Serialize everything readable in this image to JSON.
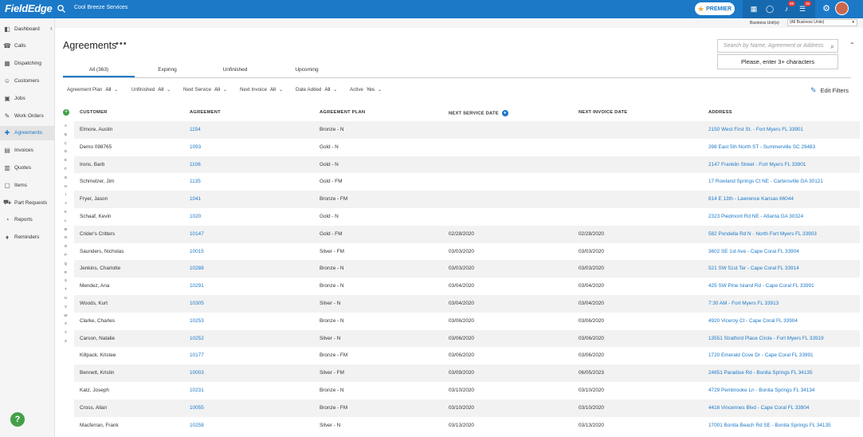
{
  "topbar": {
    "logo": "FieldEdge",
    "company": "Cool Breeze Services",
    "premier": "PREMIER",
    "badge1": "99",
    "badge2": "35"
  },
  "subbar": {
    "business_unit_label": "Business Unit(s):",
    "business_unit_value": "(All Business Units)"
  },
  "sidebar": {
    "items": [
      {
        "label": "Dashboard",
        "icon": "dashboard-icon",
        "glyph": "◧"
      },
      {
        "label": "Calls",
        "icon": "phone-icon",
        "glyph": "☎"
      },
      {
        "label": "Dispatching",
        "icon": "calendar-icon",
        "glyph": "▦"
      },
      {
        "label": "Customers",
        "icon": "user-icon",
        "glyph": "☺"
      },
      {
        "label": "Jobs",
        "icon": "briefcase-icon",
        "glyph": "▣"
      },
      {
        "label": "Work Orders",
        "icon": "wrench-icon",
        "glyph": "✎"
      },
      {
        "label": "Agreements",
        "icon": "handshake-icon",
        "glyph": "✚"
      },
      {
        "label": "Invoices",
        "icon": "invoice-icon",
        "glyph": "▤"
      },
      {
        "label": "Quotes",
        "icon": "quote-icon",
        "glyph": "▥"
      },
      {
        "label": "Items",
        "icon": "box-icon",
        "glyph": "▢"
      },
      {
        "label": "Part Requests",
        "icon": "truck-icon",
        "glyph": "⛟"
      },
      {
        "label": "Reports",
        "icon": "chart-icon",
        "glyph": "◔"
      },
      {
        "label": "Reminders",
        "icon": "bell-icon",
        "glyph": "♦"
      }
    ],
    "active_index": 6,
    "help": "?"
  },
  "page": {
    "title": "Agreements",
    "more": "•••"
  },
  "tabs": [
    {
      "label": "All (363)"
    },
    {
      "label": "Expiring"
    },
    {
      "label": "Unfinished"
    },
    {
      "label": "Upcoming"
    }
  ],
  "search": {
    "placeholder": "Search by Name, Agreement or Address",
    "hint": "Please, enter 3+ characters"
  },
  "filters": [
    {
      "label": "Agreement Plan",
      "value": "All"
    },
    {
      "label": "Unfinished",
      "value": "All"
    },
    {
      "label": "Next Service",
      "value": "All"
    },
    {
      "label": "Next Invoice",
      "value": "All"
    },
    {
      "label": "Date Added",
      "value": "All"
    },
    {
      "label": "Active",
      "value": "Yes"
    }
  ],
  "edit_filters": "Edit Filters",
  "columns": {
    "customer": "CUSTOMER",
    "agreement": "AGREEMENT",
    "plan": "AGREEMENT PLAN",
    "next_service": "NEXT SERVICE DATE",
    "next_invoice": "NEXT INVOICE DATE",
    "address": "ADDRESS"
  },
  "alphabet": [
    "A",
    "B",
    "C",
    "D",
    "E",
    "F",
    "G",
    "H",
    "I",
    "J",
    "K",
    "L",
    "M",
    "N",
    "O",
    "P",
    "Q",
    "R",
    "S",
    "T",
    "U",
    "V",
    "W",
    "X",
    "Y",
    "Z"
  ],
  "rows": [
    {
      "customer": "Elmore, Austin",
      "agreement": "1154",
      "plan": "Bronze - N",
      "next_service": "",
      "next_invoice": "",
      "address": "2150 West First St. - Fort Myers FL 33901"
    },
    {
      "customer": "Demo 098765",
      "agreement": "1093",
      "plan": "Gold - N",
      "next_service": "",
      "next_invoice": "",
      "address": "398 East 5th North ST - Summerville SC 29483"
    },
    {
      "customer": "Irons, Barb",
      "agreement": "1106",
      "plan": "Gold - N",
      "next_service": "",
      "next_invoice": "",
      "address": "2147 Franklin Street - Fort Myers FL 33901"
    },
    {
      "customer": "Schmelzer, Jim",
      "agreement": "1135",
      "plan": "Gold - FM",
      "next_service": "",
      "next_invoice": "",
      "address": "17 Rowland Springs Ct NE - Cartersville GA 30121"
    },
    {
      "customer": "Fryer, Jason",
      "agreement": "1041",
      "plan": "Bronze - FM",
      "next_service": "",
      "next_invoice": "",
      "address": "814 E 13th - Lawrence Kansas 66044"
    },
    {
      "customer": "Schaaf, Kevin",
      "agreement": "1020",
      "plan": "Gold - N",
      "next_service": "",
      "next_invoice": "",
      "address": "2323 Piedmont Rd NE - Atlanta GA 30324"
    },
    {
      "customer": "Crider's Critters",
      "agreement": "10147",
      "plan": "Gold - FM",
      "next_service": "02/28/2020",
      "next_invoice": "02/28/2020",
      "address": "582 Pondella Rd N - North Fort Myers FL 33903"
    },
    {
      "customer": "Saunders, Nicholas",
      "agreement": "10015",
      "plan": "Silver - FM",
      "next_service": "03/03/2020",
      "next_invoice": "03/03/2020",
      "address": "3602 SE 1st Ave - Cape Coral FL 33904"
    },
    {
      "customer": "Jenkins, Charlotte",
      "agreement": "10288",
      "plan": "Bronze - N",
      "next_service": "03/03/2020",
      "next_invoice": "03/03/2020",
      "address": "521 SW 51st Ter - Cape Coral FL 33914"
    },
    {
      "customer": "Mendez, Ana",
      "agreement": "10291",
      "plan": "Bronze - N",
      "next_service": "03/04/2020",
      "next_invoice": "03/04/2020",
      "address": "425 SW Pine Island Rd - Cape Coral FL 33991"
    },
    {
      "customer": "Woods, Kurt",
      "agreement": "10305",
      "plan": "Silver - N",
      "next_service": "03/04/2020",
      "next_invoice": "03/04/2020",
      "address": "7:30 AM - Fort Myers FL 33913"
    },
    {
      "customer": "Clarke, Charles",
      "agreement": "10253",
      "plan": "Bronze - N",
      "next_service": "03/06/2020",
      "next_invoice": "03/06/2020",
      "address": "4920 Viceroy Ct - Cape Coral FL 33904"
    },
    {
      "customer": "Carson, Natalie",
      "agreement": "10252",
      "plan": "Silver - N",
      "next_service": "03/06/2020",
      "next_invoice": "03/06/2020",
      "address": "13551 Stratford Place Circle - Fort Myers FL 33919"
    },
    {
      "customer": "Killpack, Kristee",
      "agreement": "10177",
      "plan": "Bronze - FM",
      "next_service": "03/06/2020",
      "next_invoice": "03/06/2020",
      "address": "1720 Emerald Cove Dr - Cape Coral FL 33991"
    },
    {
      "customer": "Bennett, Kristin",
      "agreement": "10003",
      "plan": "Silver - FM",
      "next_service": "03/09/2020",
      "next_invoice": "06/05/2023",
      "address": "24651 Paradise Rd - Bonita Springs FL 34135"
    },
    {
      "customer": "Katz, Joseph",
      "agreement": "10231",
      "plan": "Bronze - N",
      "next_service": "03/10/2020",
      "next_invoice": "03/10/2020",
      "address": "4729 Pembrooke Ln - Bonita Springs FL 34134"
    },
    {
      "customer": "Cross, Allan",
      "agreement": "10055",
      "plan": "Bronze - FM",
      "next_service": "03/10/2020",
      "next_invoice": "03/10/2020",
      "address": "4416 Vincennes Blvd - Cape Coral FL 33904"
    },
    {
      "customer": "Macferran, Frank",
      "agreement": "10258",
      "plan": "Silver - N",
      "next_service": "03/13/2020",
      "next_invoice": "03/13/2020",
      "address": "17001 Bonita Beach Rd SE - Bonita Springs FL 34135"
    }
  ]
}
